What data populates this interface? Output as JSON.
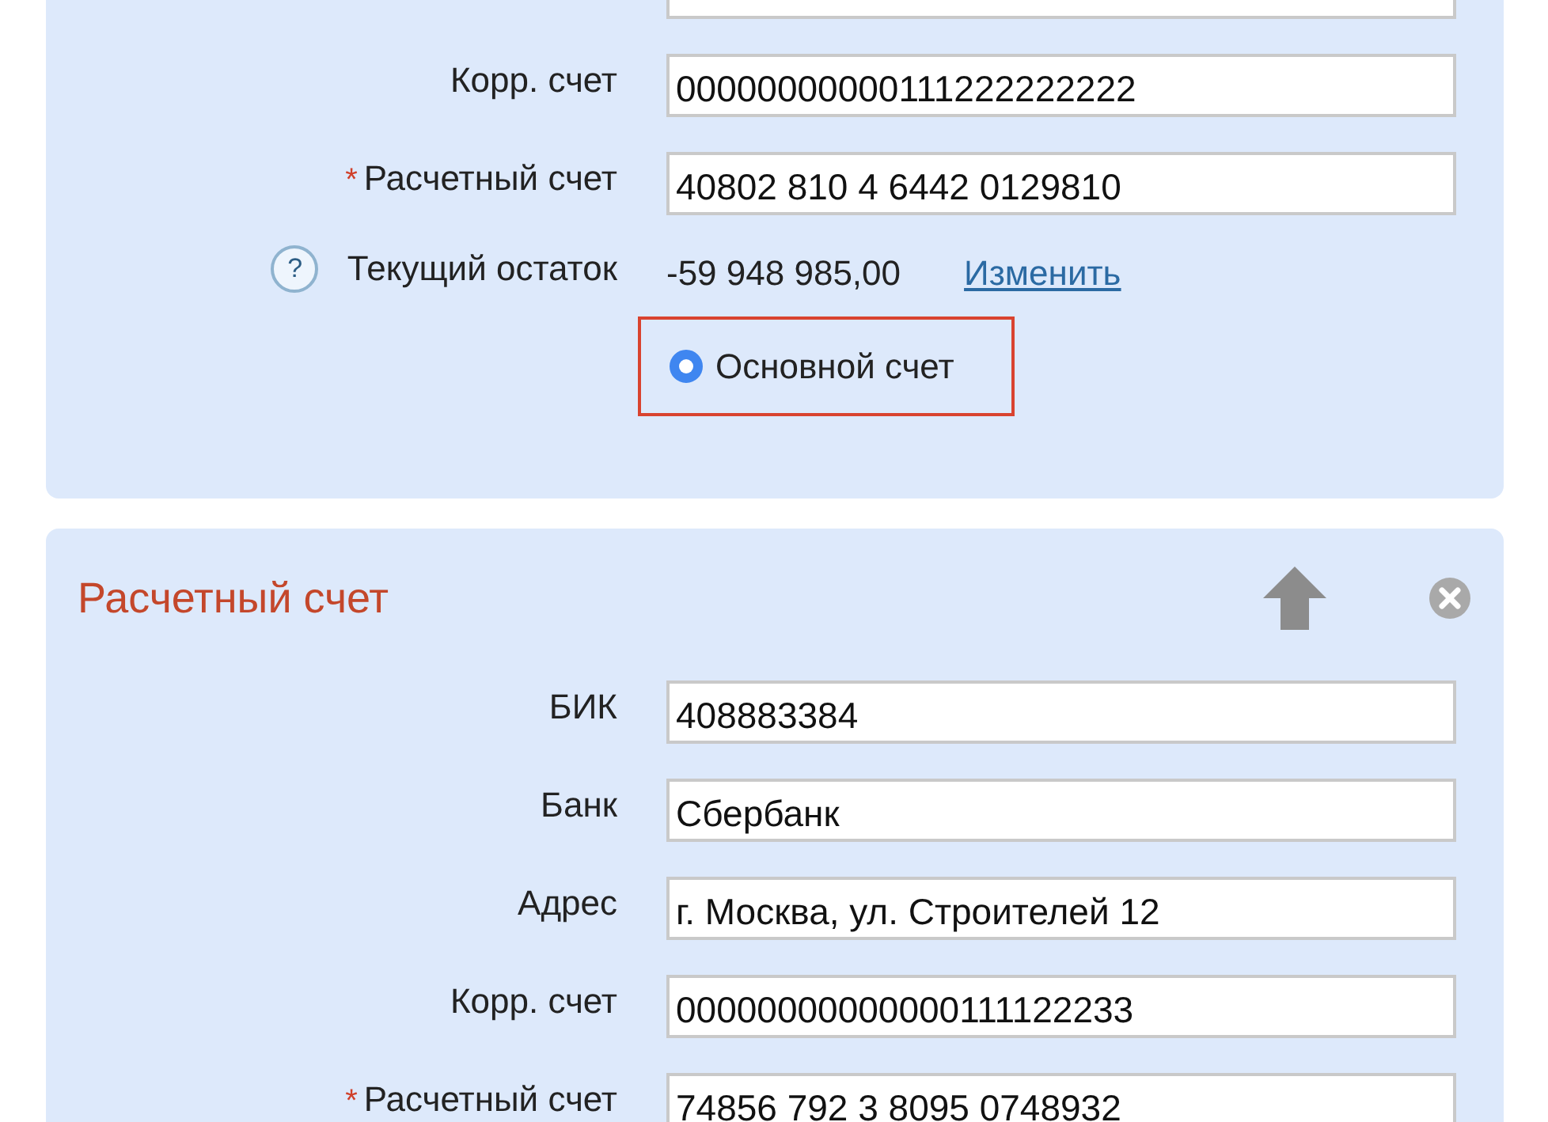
{
  "required_mark": "*",
  "accounts": [
    {
      "fields": [
        {
          "label": "Корр. счет",
          "value": "00000000000111222222222",
          "required": false
        },
        {
          "label": "Расчетный счет",
          "value": "40802 810 4 6442 0129810",
          "required": true
        }
      ],
      "balance": {
        "help_icon": "?",
        "label": "Текущий остаток",
        "value": "-59 948 985,00",
        "link": "Изменить"
      },
      "main_account": {
        "label": "Основной счет",
        "selected": true
      }
    },
    {
      "title": "Расчетный счет",
      "fields": [
        {
          "label": "БИК",
          "value": "408883384",
          "required": false
        },
        {
          "label": "Банк",
          "value": "Сбербанк",
          "required": false
        },
        {
          "label": "Адрес",
          "value": "г. Москва, ул. Строителей 12",
          "required": false
        },
        {
          "label": "Корр. счет",
          "value": "00000000000000111122233",
          "required": false
        },
        {
          "label": "Расчетный счет",
          "value": "74856 792 3 8095 0748932",
          "required": true
        }
      ]
    }
  ]
}
